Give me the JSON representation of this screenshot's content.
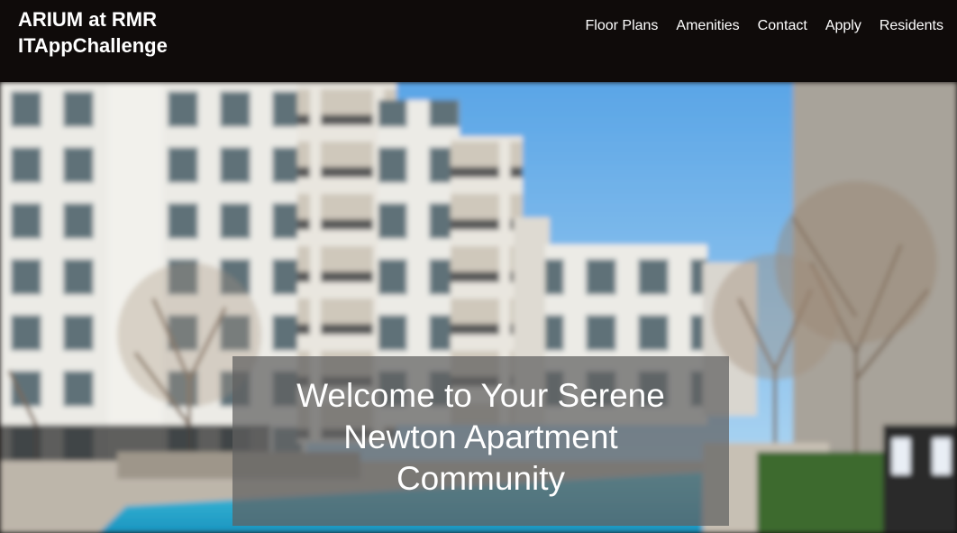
{
  "header": {
    "brand_line1": "ARIUM at RMR",
    "brand_line2": "ITAppChallenge"
  },
  "nav": {
    "items": [
      {
        "label": "Floor Plans"
      },
      {
        "label": "Amenities"
      },
      {
        "label": "Contact"
      },
      {
        "label": "Apply"
      },
      {
        "label": "Residents"
      }
    ]
  },
  "hero": {
    "caption": "Welcome to Your Serene Newton Apartment Community"
  },
  "colors": {
    "header_bg": "#0f0b0a",
    "text": "#ffffff",
    "sky": "#6fb6ea",
    "pool": "#2bb7d6",
    "caption_bg": "#5f5f5f"
  }
}
